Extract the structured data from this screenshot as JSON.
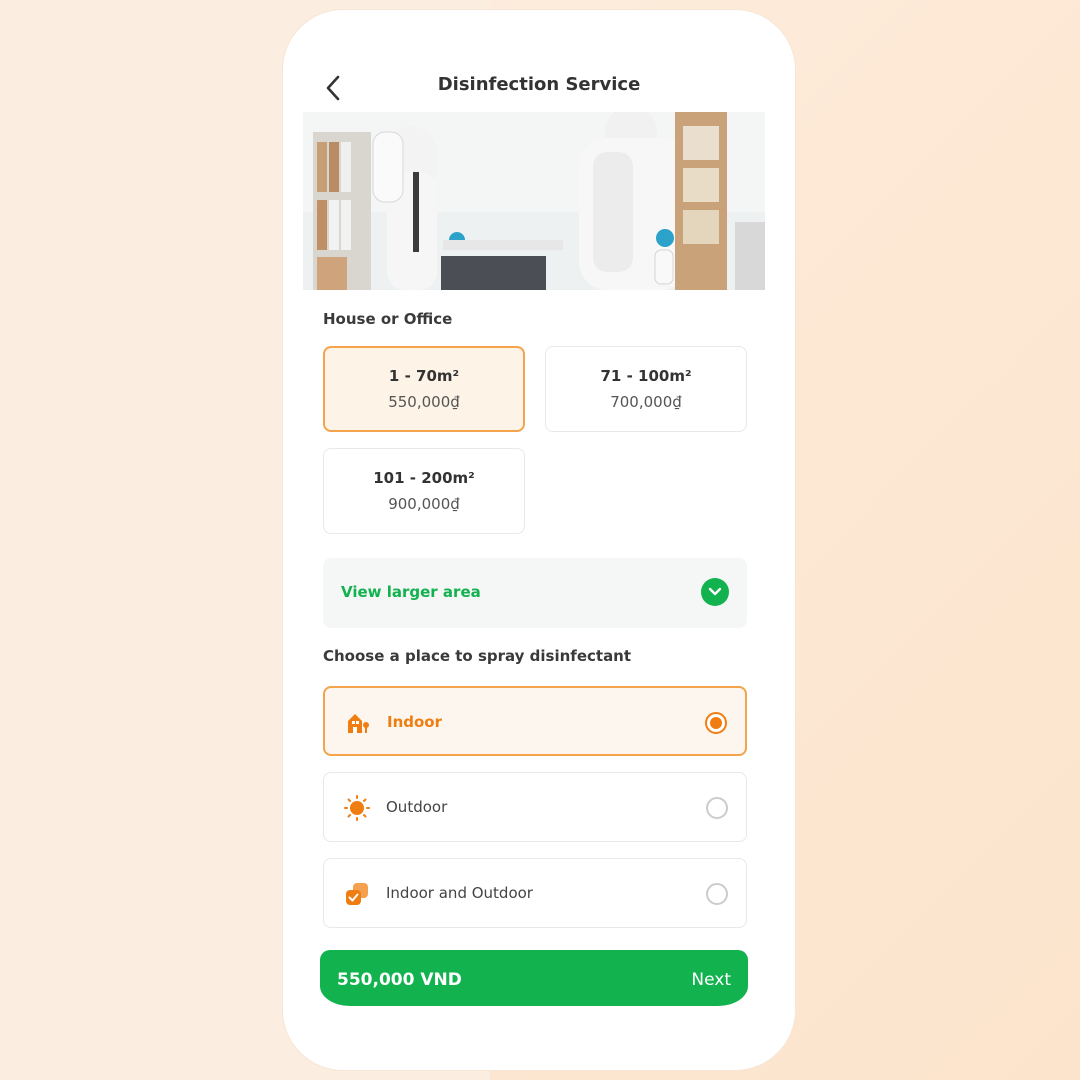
{
  "header": {
    "title": "Disinfection Service"
  },
  "hero": {
    "image": "disinfection-workers-photo"
  },
  "house_or_office": {
    "label": "House or Office",
    "options": [
      {
        "area": "1 - 70m²",
        "price": "550,000₫",
        "selected": true
      },
      {
        "area": "71 - 100m²",
        "price": "700,000₫",
        "selected": false
      },
      {
        "area": "101 - 200m²",
        "price": "900,000₫",
        "selected": false
      }
    ]
  },
  "view_larger": {
    "label": "View larger area",
    "icon": "chevron-down-icon"
  },
  "spray_place": {
    "label": "Choose a place to spray disinfectant",
    "options": [
      {
        "label": "Indoor",
        "icon": "house-icon",
        "selected": true
      },
      {
        "label": "Outdoor",
        "icon": "sun-icon",
        "selected": false
      },
      {
        "label": "Indoor and Outdoor",
        "icon": "layers-check-icon",
        "selected": false
      }
    ]
  },
  "footer": {
    "total": "550,000 VND",
    "next_label": "Next"
  },
  "colors": {
    "accent_green": "#12b24f",
    "accent_orange": "#f07d12",
    "selected_border": "#f3a44c"
  }
}
